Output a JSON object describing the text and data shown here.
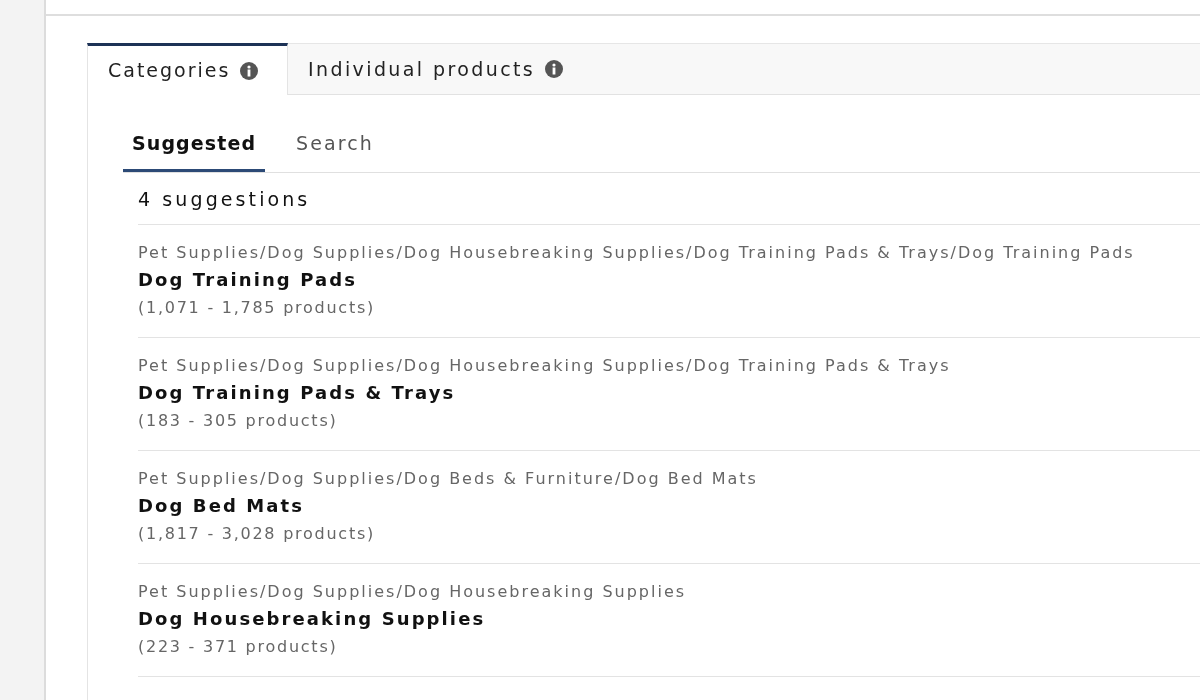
{
  "tabs": [
    {
      "label": "Categories",
      "selected": true
    },
    {
      "label": "Individual products",
      "selected": false
    }
  ],
  "sub_tabs": [
    {
      "label": "Suggested",
      "selected": true
    },
    {
      "label": "Search",
      "selected": false
    }
  ],
  "suggestion_count": "4 suggestions",
  "suggestions": [
    {
      "path": "Pet Supplies/Dog Supplies/Dog Housebreaking Supplies/Dog Training Pads & Trays/Dog Training Pads",
      "title": "Dog Training Pads",
      "count": "(1,071 - 1,785 products)"
    },
    {
      "path": "Pet Supplies/Dog Supplies/Dog Housebreaking Supplies/Dog Training Pads & Trays",
      "title": "Dog Training Pads & Trays",
      "count": "(183 - 305 products)"
    },
    {
      "path": "Pet Supplies/Dog Supplies/Dog Beds & Furniture/Dog Bed Mats",
      "title": "Dog Bed Mats",
      "count": "(1,817 - 3,028 products)"
    },
    {
      "path": "Pet Supplies/Dog Supplies/Dog Housebreaking Supplies",
      "title": "Dog Housebreaking Supplies",
      "count": "(223 - 371 products)"
    }
  ]
}
